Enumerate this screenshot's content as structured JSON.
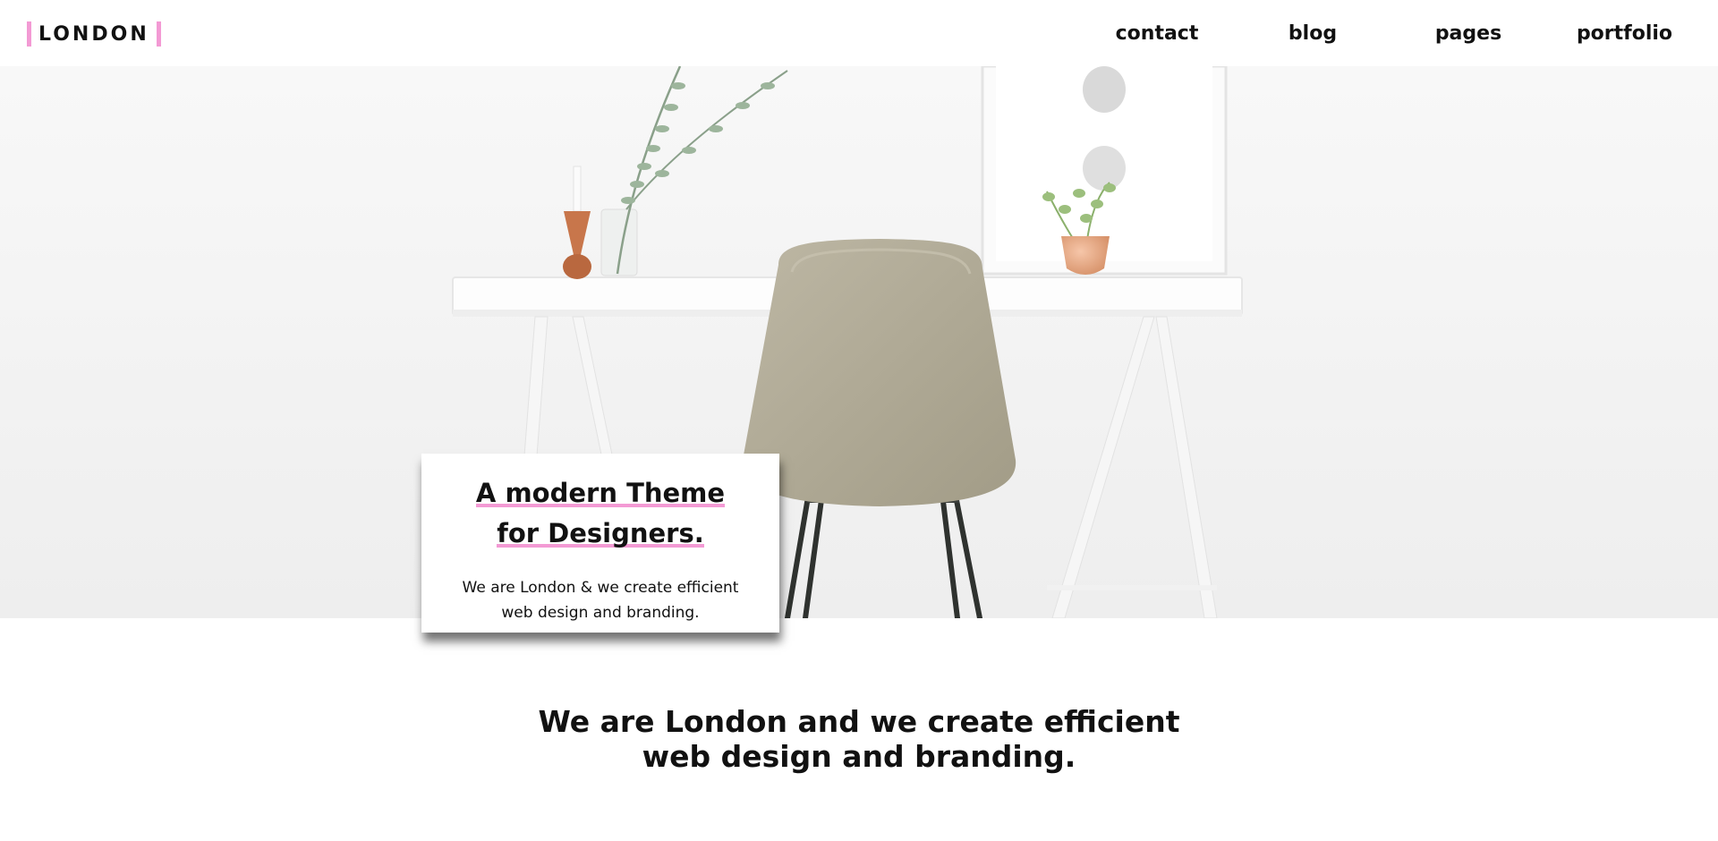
{
  "header": {
    "logo": "LONDON",
    "nav": [
      "contact",
      "blog",
      "pages",
      "portfolio"
    ]
  },
  "hero": {
    "title_line1": "A modern Theme",
    "title_line2": "for Designers.",
    "text_line1": "We are London & we create efficient",
    "text_line2": "web design and branding."
  },
  "intro": {
    "line1": "We are London and we create efficient",
    "line2": "web design and branding."
  },
  "colors": {
    "accent": "#f39ad4",
    "text": "#111111",
    "background": "#ffffff"
  },
  "icons": []
}
